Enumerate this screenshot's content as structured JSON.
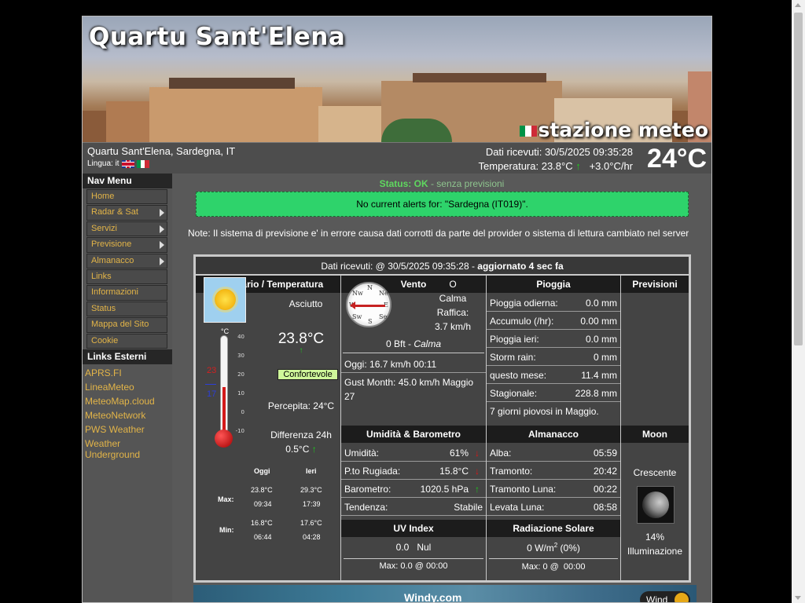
{
  "header": {
    "site_title": "Quartu Sant'Elena",
    "stazione": "stazione meteo",
    "location": "Quartu Sant'Elena, Sardegna, IT",
    "lingua_label": "Lingua: it",
    "dati_ricevuti": "Dati ricevuti:  30/5/2025  09:35:28",
    "temperatura_label": "Temperatura: 23.8°C",
    "temp_trend": "+3.0°C/hr",
    "big_temp": "24°C",
    "flag_colors": [
      "#009246",
      "#ffffff",
      "#ce2b37"
    ]
  },
  "nav_menu": {
    "title": "Nav Menu",
    "items": [
      {
        "label": "Home",
        "submenu": false
      },
      {
        "label": "Radar & Sat",
        "submenu": true
      },
      {
        "label": "Servizi",
        "submenu": true
      },
      {
        "label": "Previsione",
        "submenu": true
      },
      {
        "label": "Almanacco",
        "submenu": true
      },
      {
        "label": "Links",
        "submenu": false
      },
      {
        "label": "Informazioni",
        "submenu": false
      },
      {
        "label": "Status",
        "submenu": false
      },
      {
        "label": "Mappa del Sito",
        "submenu": false
      },
      {
        "label": "Cookie",
        "submenu": false
      }
    ]
  },
  "external_links": {
    "title": "Links Esterni",
    "items": [
      "APRS.FI",
      "LineaMeteo",
      "MeteoMap.cloud",
      "MeteoNetwork",
      "PWS Weather",
      "Weather Underground"
    ]
  },
  "status": {
    "label": "Status: OK",
    "suffix": " - senza previsioni"
  },
  "alert": "No current alerts for: \"Sardegna (IT019)\".",
  "note": "Note: Il sistema di previsione e' in errore causa dati corrotti da parte del provider o sistema di lettura cambiato nel server",
  "panel": {
    "header_prefix": "Dati ricevuti: @ 30/5/2025 09:35:28 - ",
    "header_bold": "aggiornato 4 sec fa",
    "col_titles": {
      "sommario": "Sommario / Temperatura",
      "vento": "Vento",
      "pioggia": "Pioggia",
      "previsioni": "Previsioni",
      "umidita": "Umidità & Barometro",
      "almanacco": "Almanacco",
      "moon": "Moon",
      "uv": "UV Index",
      "radiazione": "Radiazione Solare"
    },
    "sommario": {
      "condition": "Asciutto",
      "temperature": "23.8°C",
      "comfort": "Confortevole",
      "percepita": "Percepita: 24°C",
      "diff_label": "Differenza 24h",
      "diff_value": "0.5°C",
      "thermo_unit": "°C",
      "thermo_high_marker": "23",
      "thermo_low_marker": "17",
      "thermo_ticks": [
        "40",
        "30",
        "20",
        "10",
        "0",
        "-10"
      ],
      "thermo_level_pct": 55,
      "maxmin": {
        "col_oggi": "Oggi",
        "col_ieri": "Ieri",
        "max_label": "Max:",
        "min_label": "Min:",
        "max_oggi_val": "23.8°C",
        "max_oggi_time": "09:34",
        "max_ieri_val": "29.3°C",
        "max_ieri_time": "17:39",
        "min_oggi_val": "16.8°C",
        "min_oggi_time": "06:44",
        "min_ieri_val": "17.6°C",
        "min_ieri_time": "04:28"
      }
    },
    "vento": {
      "direction": "O",
      "state": "Calma",
      "raffica_label": "Raffica:",
      "raffica": "3.7 km/h",
      "bft": "0 Bft - ",
      "bft_desc": "Calma",
      "oggi": "Oggi: 16.7 km/h 00:11",
      "gust_month": "Gust Month: 45.0 km/h Maggio 27",
      "compass_labels": [
        "N",
        "Ne",
        "E",
        "Se",
        "S",
        "Sw",
        "W",
        "Nw"
      ]
    },
    "pioggia": [
      {
        "label": "Pioggia odierna:",
        "value": "0.0 mm"
      },
      {
        "label": "Accumulo (/hr):",
        "value": "0.00 mm"
      },
      {
        "label": "Pioggia ieri:",
        "value": "0.0 mm"
      },
      {
        "label": "Storm rain:",
        "value": "0 mm"
      },
      {
        "label": "questo mese:",
        "value": "11.4 mm"
      },
      {
        "label": "Stagionale:",
        "value": "228.8 mm"
      }
    ],
    "pioggia_footer": "7 giorni piovosi in Maggio.",
    "umidita": [
      {
        "label": "Umidità:",
        "value": "61%"
      },
      {
        "label": "P.to Rugiada:",
        "value": "15.8°C"
      },
      {
        "label": "Barometro:",
        "value": "1020.5 hPa"
      },
      {
        "label": "Tendenza:",
        "value": "Stabile"
      }
    ],
    "almanacco": [
      {
        "label": "Alba:",
        "value": "05:59"
      },
      {
        "label": "Tramonto:",
        "value": "20:42"
      },
      {
        "label": "Tramonto Luna:",
        "value": "00:22"
      },
      {
        "label": "Levata Luna:",
        "value": "08:58"
      }
    ],
    "moon": {
      "phase": "Crescente",
      "illumination_pct": "14%",
      "illumination_label": "Illuminazione"
    },
    "uv": {
      "value": "0.0   Nul",
      "max": "Max: 0.0 @ 00:00"
    },
    "radiazione": {
      "value_prefix": "0 W/m",
      "value_sup": "2",
      "value_suffix": " (0%)",
      "max": "Max: 0 @  00:00"
    }
  },
  "windy": {
    "logo": "Windy.com",
    "button": "Wind"
  }
}
